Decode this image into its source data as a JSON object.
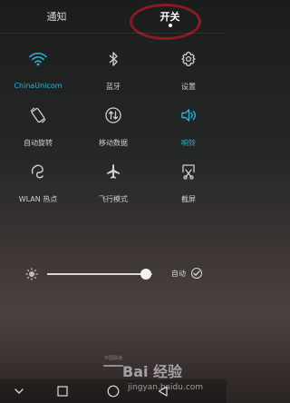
{
  "tabs": {
    "notifications_label": "通知",
    "toggles_label": "开关"
  },
  "tiles": [
    {
      "name": "wifi",
      "label": "ChinaUnicom",
      "active": true,
      "icon": "wifi-icon"
    },
    {
      "name": "bluetooth",
      "label": "蓝牙",
      "active": false,
      "icon": "bluetooth-icon"
    },
    {
      "name": "settings",
      "label": "设置",
      "active": false,
      "icon": "gear-icon"
    },
    {
      "name": "auto-rotate",
      "label": "自动旋转",
      "active": false,
      "icon": "rotate-icon"
    },
    {
      "name": "mobile-data",
      "label": "移动数据",
      "active": false,
      "icon": "mobile-data-icon"
    },
    {
      "name": "ringer",
      "label": "响铃",
      "active": true,
      "icon": "speaker-icon"
    },
    {
      "name": "wlan-hotspot",
      "label": "WLAN 热点",
      "active": false,
      "icon": "hotspot-icon"
    },
    {
      "name": "airplane-mode",
      "label": "飞行模式",
      "active": false,
      "icon": "airplane-icon"
    },
    {
      "name": "screenshot",
      "label": "截屏",
      "active": false,
      "icon": "screenshot-icon"
    }
  ],
  "brightness": {
    "level": 0.94,
    "auto_label": "自动",
    "auto_checked": true
  },
  "carrier_text": "中国联通",
  "watermark": {
    "main": "Bai 经验",
    "sub": "jingyan.baidu.com"
  },
  "colors": {
    "accent": "#2ab1d8",
    "annotation": "#8a1b22"
  }
}
